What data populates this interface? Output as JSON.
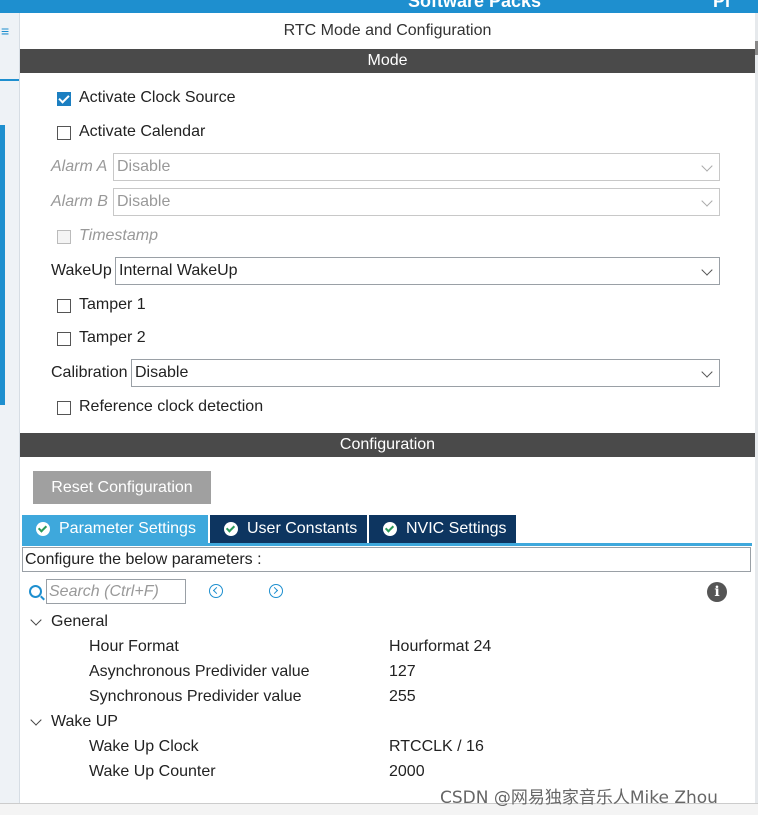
{
  "top_bar": {
    "left_text": "Software Packs",
    "right_text": "Pi"
  },
  "panel_title": "RTC Mode and Configuration",
  "mode": {
    "header": "Mode",
    "activate_clock_source": {
      "label": "Activate Clock Source",
      "checked": true
    },
    "activate_calendar": {
      "label": "Activate Calendar",
      "checked": false
    },
    "alarm_a": {
      "label": "Alarm A",
      "value": "Disable"
    },
    "alarm_b": {
      "label": "Alarm B",
      "value": "Disable"
    },
    "timestamp": {
      "label": "Timestamp",
      "checked": false
    },
    "wakeup": {
      "label": "WakeUp",
      "value": "Internal WakeUp"
    },
    "tamper1": {
      "label": "Tamper 1",
      "checked": false
    },
    "tamper2": {
      "label": "Tamper 2",
      "checked": false
    },
    "calibration": {
      "label": "Calibration",
      "value": "Disable"
    },
    "reference_clock": {
      "label": "Reference clock detection",
      "checked": false
    }
  },
  "configuration": {
    "header": "Configuration",
    "reset_label": "Reset Configuration",
    "tabs": [
      {
        "label": "Parameter Settings",
        "active": true
      },
      {
        "label": "User Constants",
        "active": false
      },
      {
        "label": "NVIC Settings",
        "active": false
      }
    ],
    "description": "Configure the below parameters :",
    "search_placeholder": "Search (Ctrl+F)",
    "groups": [
      {
        "name": "General",
        "params": [
          {
            "name": "Hour Format",
            "value": "Hourformat 24"
          },
          {
            "name": "Asynchronous Predivider value",
            "value": "127"
          },
          {
            "name": "Synchronous Predivider value",
            "value": "255"
          }
        ]
      },
      {
        "name": "Wake UP",
        "params": [
          {
            "name": "Wake Up Clock",
            "value": "RTCCLK / 16"
          },
          {
            "name": "Wake Up Counter",
            "value": "2000"
          }
        ]
      }
    ]
  },
  "watermark": "CSDN @网易独家音乐人Mike Zhou",
  "colors": {
    "accent": "#1e8fcf",
    "tab_active": "#3ea8dc",
    "tab_inactive": "#0d3560",
    "section_header": "#4a4a4a",
    "reset_button": "#a0a0a0"
  },
  "icons": {
    "search": "search-icon",
    "info": "info-icon",
    "tab_check": "check-circle-icon"
  }
}
